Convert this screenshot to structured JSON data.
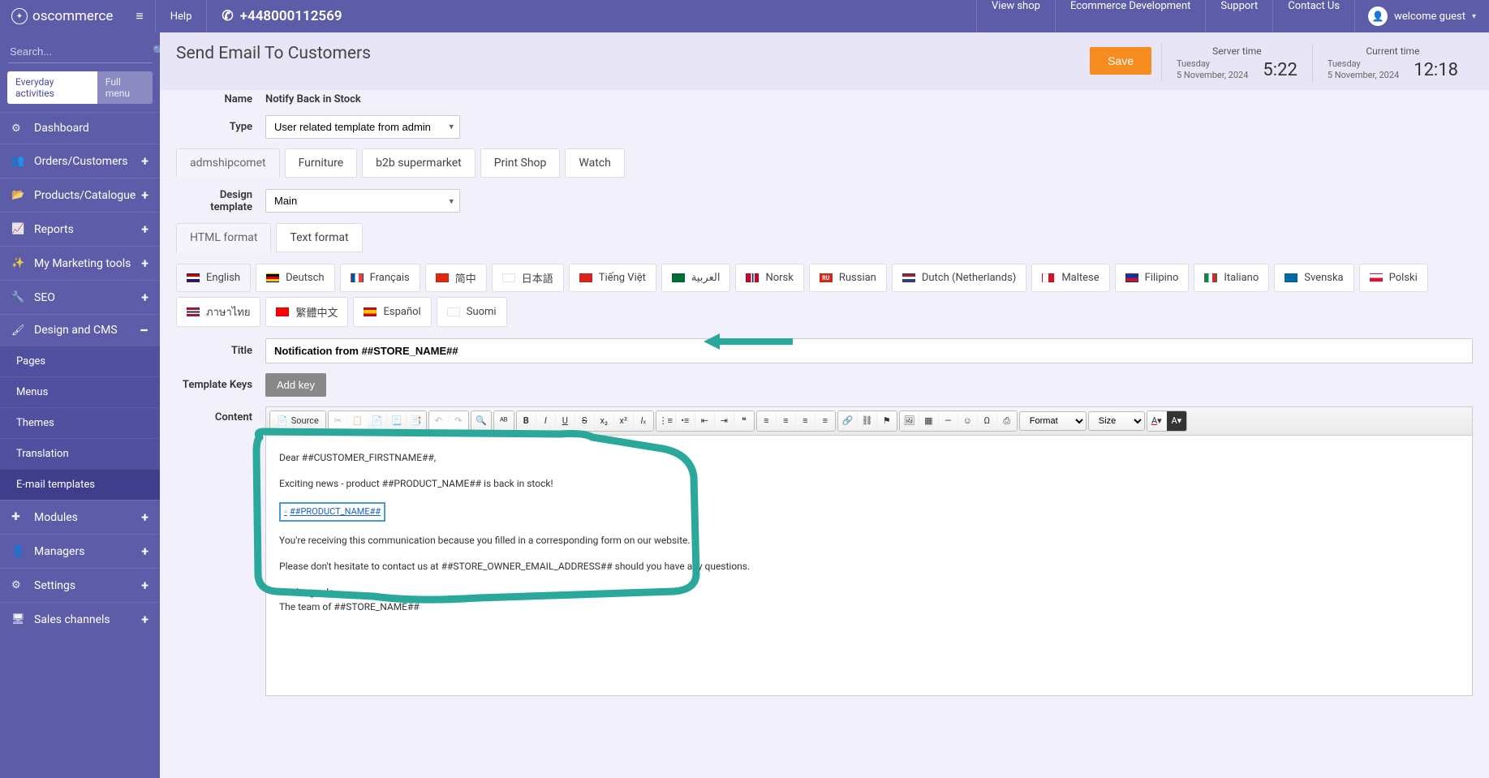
{
  "brand": "oscommerce",
  "topbar": {
    "help": "Help",
    "phone": "+448000112569",
    "links": [
      "View shop",
      "Ecommerce Development",
      "Support",
      "Contact Us"
    ],
    "user": "welcome guest"
  },
  "sidebar": {
    "search_placeholder": "Search...",
    "mode_everyday": "Everyday activities",
    "mode_full": "Full menu",
    "items": [
      {
        "icon": "dashboard",
        "label": "Dashboard",
        "expand": false
      },
      {
        "icon": "users",
        "label": "Orders/Customers",
        "expand": true
      },
      {
        "icon": "folder",
        "label": "Products/Catalogue",
        "expand": true
      },
      {
        "icon": "chart",
        "label": "Reports",
        "expand": true
      },
      {
        "icon": "wand",
        "label": "My Marketing tools",
        "expand": true
      },
      {
        "icon": "seo",
        "label": "SEO",
        "expand": true
      },
      {
        "icon": "brush",
        "label": "Design and CMS",
        "expand": true,
        "open": true,
        "subs": [
          {
            "label": "Pages"
          },
          {
            "label": "Menus"
          },
          {
            "label": "Themes"
          },
          {
            "label": "Translation"
          },
          {
            "label": "E-mail templates",
            "active": true
          }
        ]
      },
      {
        "icon": "modules",
        "label": "Modules",
        "expand": true
      },
      {
        "icon": "managers",
        "label": "Managers",
        "expand": true
      },
      {
        "icon": "gears",
        "label": "Settings",
        "expand": true
      },
      {
        "icon": "display",
        "label": "Sales channels",
        "expand": true
      }
    ]
  },
  "header": {
    "title": "Send Email To Customers",
    "save": "Save",
    "server_time_label": "Server time",
    "server_day": "Tuesday",
    "server_date": "5 November, 2024",
    "server_clock": "5:22",
    "current_time_label": "Current time",
    "current_day": "Tuesday",
    "current_date": "5 November, 2024",
    "current_clock": "12:18"
  },
  "form": {
    "name_label": "Name",
    "name_value": "Notify Back in Stock",
    "type_label": "Type",
    "type_value": "User related template from admin",
    "shop_tabs": [
      "admshipcomet",
      "Furniture",
      "b2b supermarket",
      "Print Shop",
      "Watch"
    ],
    "design_template_label": "Design template",
    "design_template_value": "Main",
    "format_tabs": [
      "HTML format",
      "Text format"
    ],
    "languages": [
      {
        "label": "English",
        "flag": "gb"
      },
      {
        "label": "Deutsch",
        "flag": "de"
      },
      {
        "label": "Français",
        "flag": "fr"
      },
      {
        "label": "简中",
        "flag": "cn"
      },
      {
        "label": "日本語",
        "flag": "jp"
      },
      {
        "label": "Tiếng Việt",
        "flag": "vn"
      },
      {
        "label": "العربية",
        "flag": "sa"
      },
      {
        "label": "Norsk",
        "flag": "no"
      },
      {
        "label": "Russian",
        "flag": "ru"
      },
      {
        "label": "Dutch (Netherlands)",
        "flag": "nl"
      },
      {
        "label": "Maltese",
        "flag": "mt"
      },
      {
        "label": "Filipino",
        "flag": "ph"
      },
      {
        "label": "Italiano",
        "flag": "it"
      },
      {
        "label": "Svenska",
        "flag": "se"
      },
      {
        "label": "Polski",
        "flag": "pl"
      },
      {
        "label": "ภาษาไทย",
        "flag": "th"
      },
      {
        "label": "繁體中文",
        "flag": "tw"
      },
      {
        "label": "Español",
        "flag": "es"
      },
      {
        "label": "Suomi",
        "flag": "fi"
      }
    ],
    "title_label": "Title",
    "title_value": "Notification from ##STORE_NAME##",
    "template_keys_label": "Template Keys",
    "add_key": "Add key",
    "content_label": "Content",
    "source_btn": "Source",
    "format_select": "Format",
    "size_select": "Size",
    "body": {
      "p1": "Dear ##CUSTOMER_FIRSTNAME##,",
      "p2": "Exciting news - product ##PRODUCT_NAME## is back in stock!",
      "img": "##PRODUCT_NAME##",
      "p3": "You're receiving this communication because you filled in a corresponding form on our website.",
      "p4": "Please don't hesitate to contact us at ##STORE_OWNER_EMAIL_ADDRESS## should you have any questions.",
      "p5a": "Kind regards,",
      "p5b": "The team of ##STORE_NAME##"
    }
  }
}
